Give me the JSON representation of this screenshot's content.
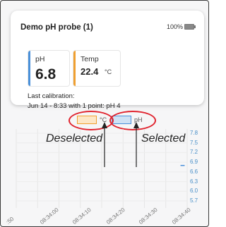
{
  "device": {
    "name": "Demo pH probe (1)",
    "battery_text": "100%",
    "battery_icon": "battery-full-icon"
  },
  "tiles": [
    {
      "label": "pH",
      "value": "6.8",
      "unit": "",
      "accent": "#4a90d9"
    },
    {
      "label": "Temp",
      "value": "22.4",
      "unit": "°C",
      "accent": "#f0a030"
    }
  ],
  "calibration": {
    "line1": "Last calibration:",
    "line2": "Jun 14 - 8:33 with 1 point: pH 4"
  },
  "legend": [
    {
      "label": "°C",
      "color": "#f0a030",
      "state": "deselected"
    },
    {
      "label": "pH",
      "color": "#4a90d9",
      "state": "selected"
    }
  ],
  "annotations": {
    "deselected": "Deselected",
    "selected": "Selected",
    "color": "#e0232e"
  },
  "chart_data": {
    "type": "line",
    "y_ticks": [
      "7.8",
      "7.5",
      "7.2",
      "6.9",
      "6.6",
      "6.3",
      "6.0",
      "5.7"
    ],
    "x_ticks": [
      ":50",
      "08:34:00",
      "08:34:10",
      "08:34:20",
      "08:34:30",
      "08:34:40"
    ],
    "series": [
      {
        "color": "#4a90d9",
        "points": [
          [
            0.86,
            6.8
          ],
          [
            0.88,
            6.8
          ]
        ]
      }
    ],
    "grid": true
  }
}
